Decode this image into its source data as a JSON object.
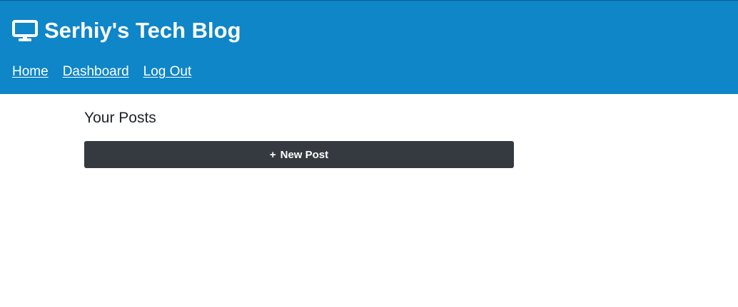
{
  "header": {
    "title": "Serhiy's Tech Blog",
    "icon": "monitor-icon",
    "background_color": "#0e86c8"
  },
  "nav": {
    "items": [
      {
        "label": "Home"
      },
      {
        "label": "Dashboard"
      },
      {
        "label": "Log Out"
      }
    ]
  },
  "main": {
    "section_title": "Your Posts",
    "new_post_button": {
      "prefix": "+",
      "label": "New Post",
      "background_color": "#343a40"
    }
  }
}
